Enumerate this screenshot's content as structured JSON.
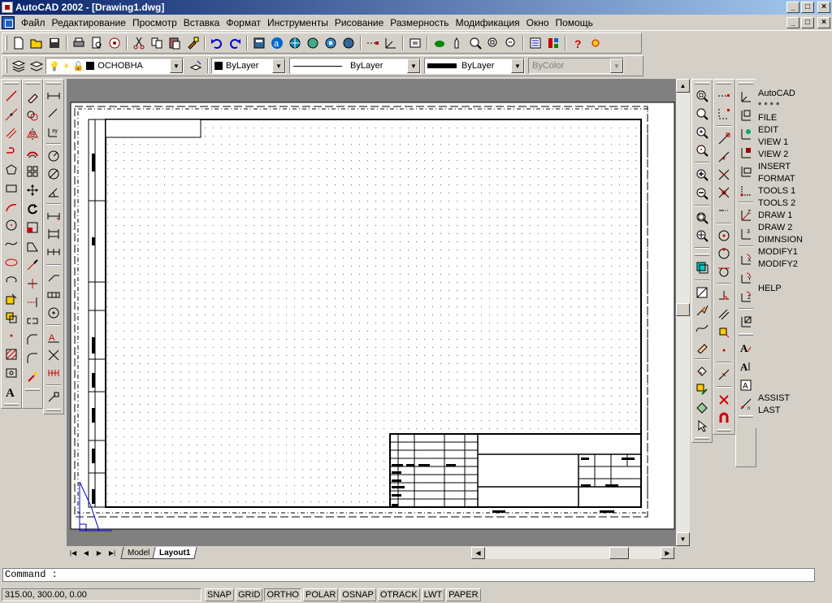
{
  "window": {
    "title": "AutoCAD 2002 - [Drawing1.dwg]",
    "min": "_",
    "max": "□",
    "close": "×"
  },
  "menu": {
    "items": [
      "Файл",
      "Редактирование",
      "Просмотр",
      "Вставка",
      "Формат",
      "Инструменты",
      "Рисование",
      "Размерность",
      "Модификация",
      "Окно",
      "Помощь"
    ]
  },
  "layers": {
    "current": "ОСНОВНА"
  },
  "properties": {
    "color": "ByLayer",
    "linetype": "ByLayer",
    "lineweight": "ByLayer",
    "plotstyle": "ByColor"
  },
  "tabs": {
    "model": "Model",
    "layout": "Layout1"
  },
  "screen_menu": {
    "items": [
      "AutoCAD",
      "* * * *",
      "FILE",
      "EDIT",
      "VIEW 1",
      "VIEW 2",
      "INSERT",
      "FORMAT",
      "TOOLS 1",
      "TOOLS 2",
      "DRAW 1",
      "DRAW 2",
      "DIMNSION",
      "MODIFY1",
      "MODIFY2",
      "",
      "HELP",
      "",
      "",
      "",
      "",
      "",
      "",
      "",
      "",
      "ASSIST",
      "LAST"
    ]
  },
  "command": {
    "prompt": "Command :"
  },
  "status": {
    "coords": "315.00, 300.00, 0.00",
    "buttons": [
      "SNAP",
      "GRID",
      "ORTHO",
      "POLAR",
      "OSNAP",
      "OTRACK",
      "LWT",
      "PAPER"
    ]
  },
  "colors": {
    "title_start": "#0a246a",
    "title_end": "#a6caf0",
    "face": "#d4d0c8",
    "model_bg": "#808080"
  }
}
